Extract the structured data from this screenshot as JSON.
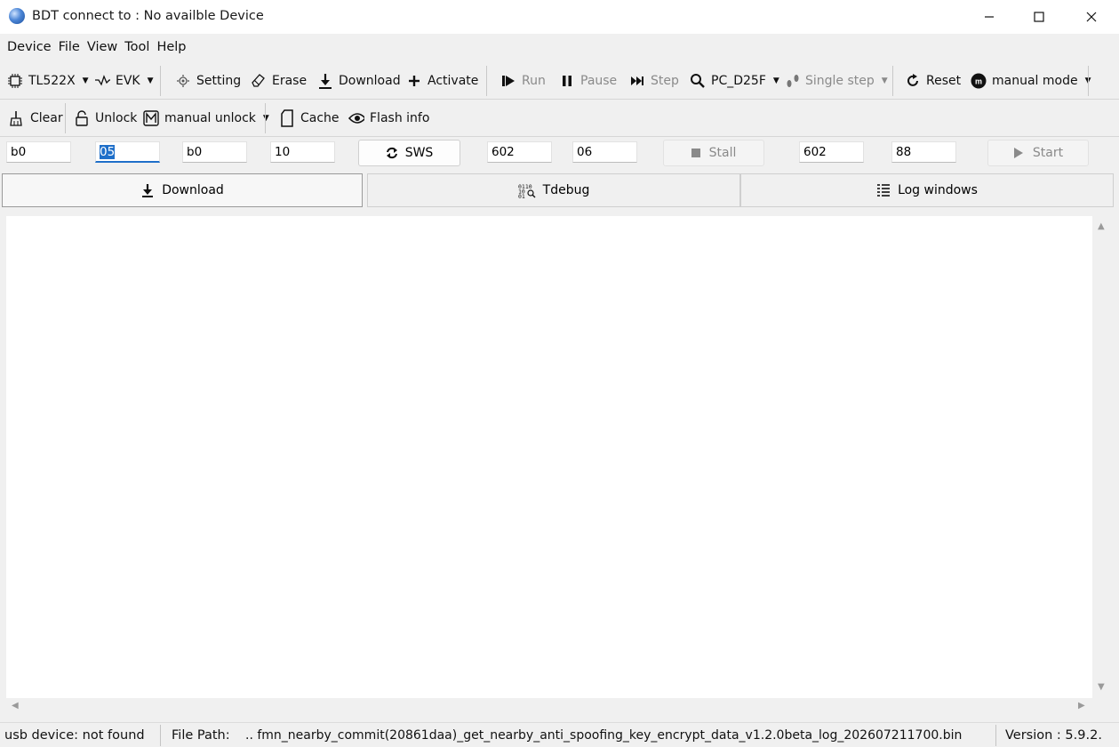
{
  "window": {
    "title": "BDT connect to : No availble Device"
  },
  "menu": [
    "Device",
    "File",
    "View",
    "Tool",
    "Help"
  ],
  "toolbar1": {
    "chip": "TL522X",
    "board": "EVK",
    "setting": "Setting",
    "erase": "Erase",
    "download": "Download",
    "activate": "Activate",
    "run": "Run",
    "pause": "Pause",
    "step": "Step",
    "pc": "PC_D25F",
    "single_step": "Single step",
    "reset": "Reset",
    "mode": "manual mode"
  },
  "toolbar2": {
    "clear": "Clear",
    "unlock": "Unlock",
    "manual_unlock": "manual unlock",
    "cache": "Cache",
    "flash_info": "Flash info"
  },
  "inputs": {
    "f1": "b0",
    "f2": "05",
    "f3": "b0",
    "f4": "10",
    "sws": "SWS",
    "f5": "602",
    "f6": "06",
    "stall": "Stall",
    "f7": "602",
    "f8": "88",
    "start": "Start"
  },
  "tabs": [
    "Download",
    "Tdebug",
    "Log windows"
  ],
  "status": {
    "usb": "usb device: not found",
    "file_path_label": "File Path:",
    "file_path": "..  fmn_nearby_commit(20861daa)_get_nearby_anti_spoofing_key_encrypt_data_v1.2.0beta_log_202607211700.bin",
    "version": "Version : 5.9.2."
  }
}
